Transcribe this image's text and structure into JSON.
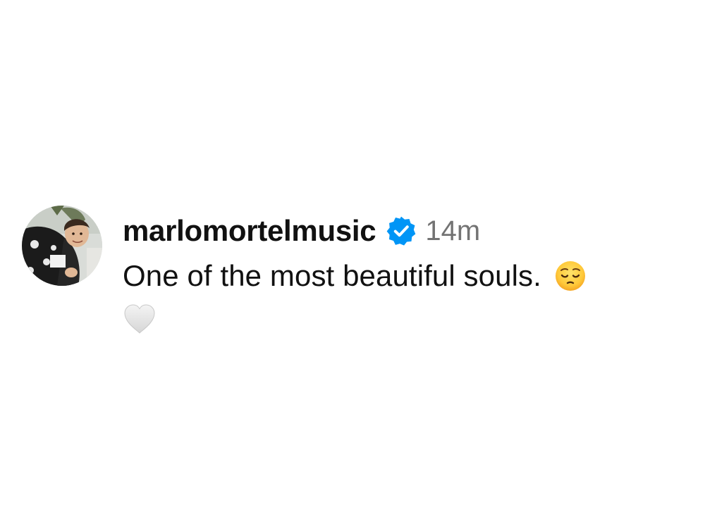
{
  "comment": {
    "username": "marlomortelmusic",
    "verified": true,
    "timestamp": "14m",
    "text": "One of the most beautiful souls.",
    "emoji": "pensive-face",
    "like_icon": "white-heart-icon"
  },
  "colors": {
    "verified_blue": "#0095F6",
    "timestamp_gray": "#737373",
    "text": "#111111"
  }
}
